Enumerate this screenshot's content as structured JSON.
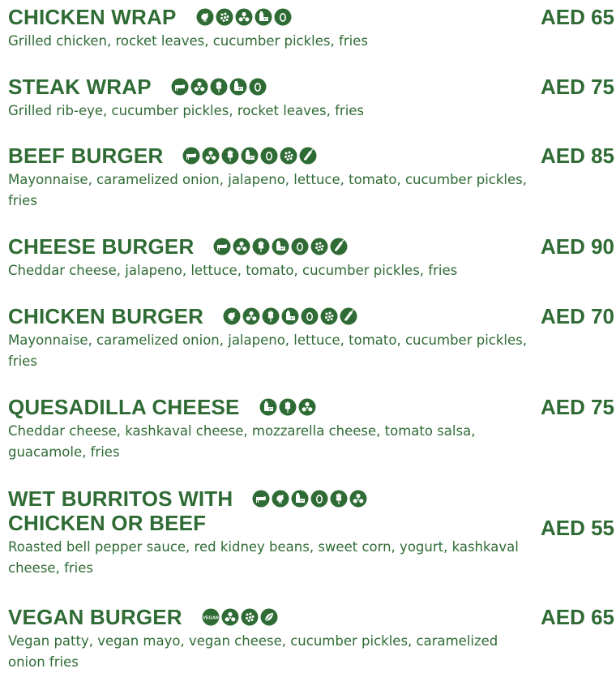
{
  "theme": {
    "accent": "#2f6b34"
  },
  "items": [
    {
      "name": "CHICKEN WRAP",
      "price": "AED 65",
      "description": "Grilled chicken, rocket leaves, cucumber pickles, fries",
      "icons": [
        "chicken-icon",
        "seeds-icon",
        "nuts-icon",
        "dairy-icon",
        "egg-icon"
      ]
    },
    {
      "name": "STEAK WRAP",
      "price": "AED 75",
      "description": "Grilled rib-eye, cucumber pickles, rocket leaves, fries",
      "icons": [
        "beef-icon",
        "nuts-icon",
        "gluten-icon",
        "dairy-icon",
        "egg-icon"
      ]
    },
    {
      "name": "BEEF BURGER",
      "price": "AED 85",
      "description": "Mayonnaise, caramelized onion, jalapeno, lettuce, tomato, cucumber pickles, fries",
      "icons": [
        "beef-icon",
        "nuts-icon",
        "gluten-icon",
        "dairy-icon",
        "egg-icon",
        "seeds-icon",
        "chili-icon"
      ]
    },
    {
      "name": "CHEESE BURGER",
      "price": "AED 90",
      "description": "Cheddar cheese, jalapeno, lettuce, tomato, cucumber pickles, fries",
      "icons": [
        "beef-icon",
        "nuts-icon",
        "gluten-icon",
        "dairy-icon",
        "egg-icon",
        "seeds-icon",
        "chili-icon"
      ]
    },
    {
      "name": "CHICKEN BURGER",
      "price": "AED 70",
      "description": "Mayonnaise, caramelized onion, jalapeno, lettuce, tomato, cucumber pickles, fries",
      "icons": [
        "chicken-icon",
        "nuts-icon",
        "gluten-icon",
        "dairy-icon",
        "egg-icon",
        "seeds-icon",
        "chili-icon"
      ]
    },
    {
      "name": "QUESADILLA CHEESE",
      "price": "AED 75",
      "description": "Cheddar cheese, kashkaval cheese, mozzarella cheese, tomato salsa, guacamole, fries",
      "icons": [
        "dairy-icon",
        "gluten-icon",
        "nuts-icon"
      ]
    },
    {
      "name": "WET BURRITOS WITH",
      "name_line2": "CHICKEN OR BEEF",
      "price": "AED 55",
      "description": "Roasted bell pepper sauce, red kidney beans, sweet corn, yogurt, kashkaval cheese, fries",
      "icons": [
        "beef-icon",
        "chicken-icon",
        "dairy-icon",
        "egg-icon",
        "gluten-icon",
        "nuts-icon"
      ]
    },
    {
      "name": "VEGAN BURGER",
      "price": "AED 65",
      "description": "Vegan patty, vegan mayo, vegan cheese, cucumber pickles, caramelized onion fries",
      "icons": [
        "vegan-icon",
        "nuts-icon",
        "seeds-icon",
        "leaf-icon"
      ]
    }
  ]
}
